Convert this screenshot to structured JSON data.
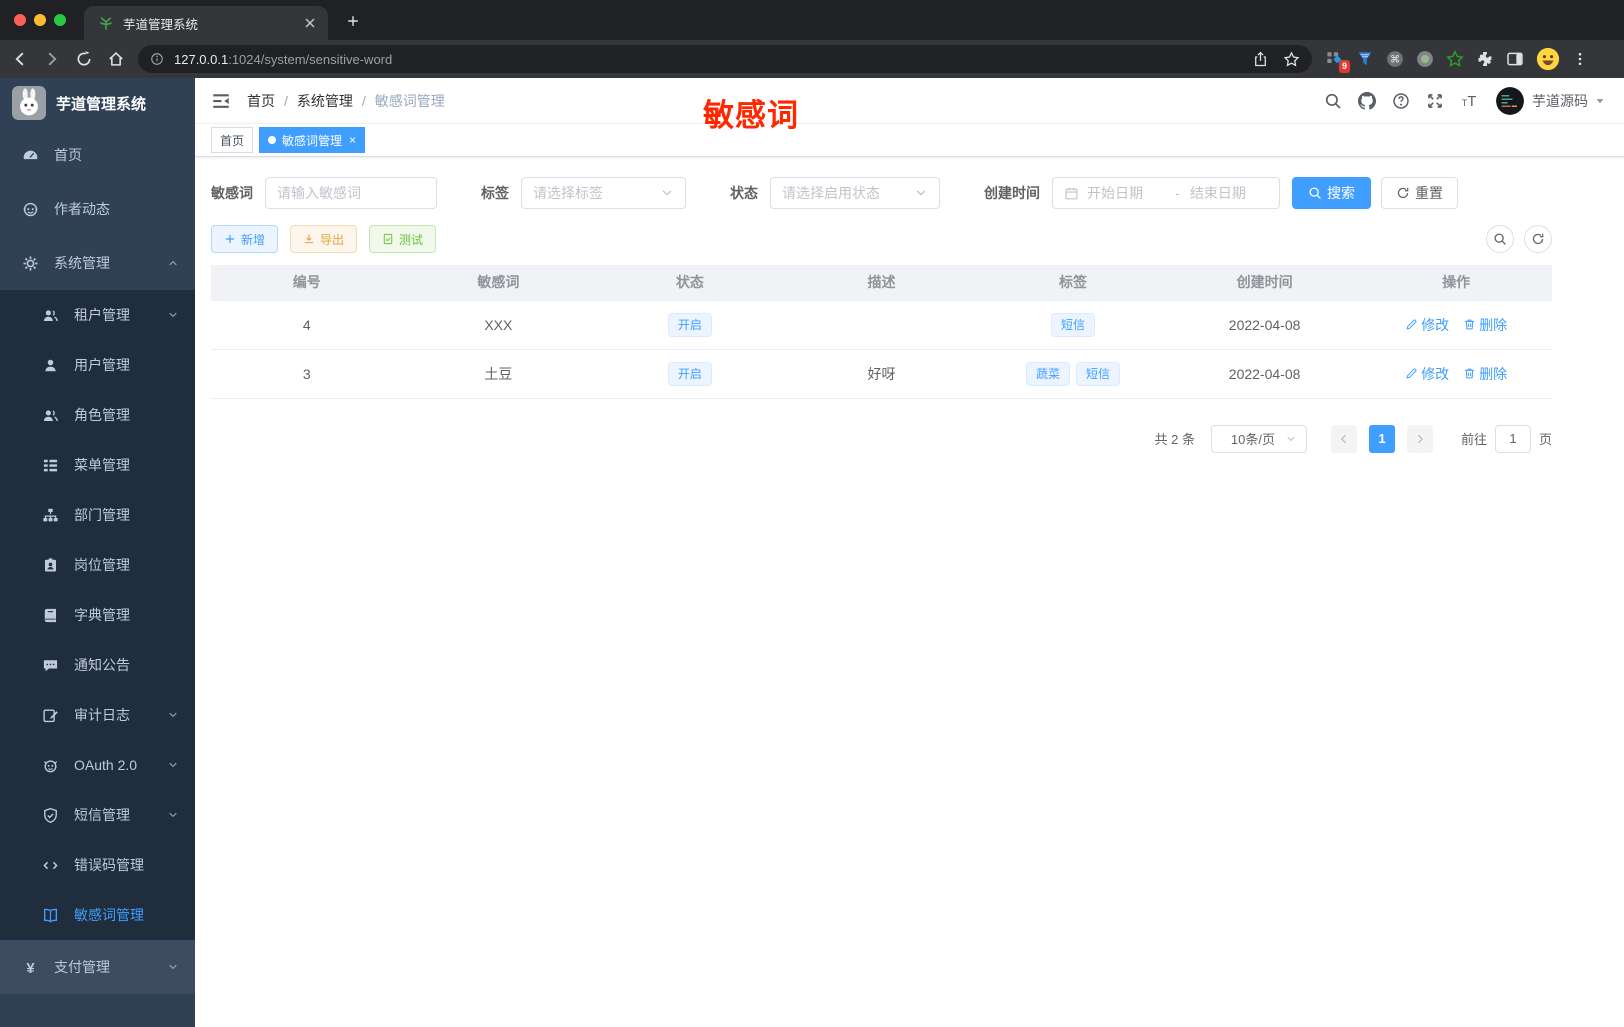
{
  "browser": {
    "tab_title": "芋道管理系统",
    "url_host": "127.0.0.1",
    "url_rest": ":1024/system/sensitive-word",
    "extension_badge": "9",
    "extensions": [
      "workona-icon",
      "funnel-icon",
      "command-circle-icon",
      "record-circle-icon",
      "green-star-icon",
      "puzzle-icon",
      "split-view-icon",
      "profile-avatar-icon",
      "menu-dots-icon"
    ]
  },
  "sidebar": {
    "title": "芋道管理系统",
    "items": [
      {
        "label": "首页",
        "icon": "gauge-icon",
        "level": 1
      },
      {
        "label": "作者动态",
        "icon": "author-icon",
        "level": 1
      },
      {
        "label": "系统管理",
        "icon": "gear-icon",
        "level": 1,
        "chevron": "up"
      },
      {
        "label": "租户管理",
        "icon": "users-icon",
        "level": 2,
        "chevron": "down"
      },
      {
        "label": "用户管理",
        "icon": "user-icon",
        "level": 2
      },
      {
        "label": "角色管理",
        "icon": "users-icon",
        "level": 2
      },
      {
        "label": "菜单管理",
        "icon": "menu-tree-icon",
        "level": 2
      },
      {
        "label": "部门管理",
        "icon": "org-icon",
        "level": 2
      },
      {
        "label": "岗位管理",
        "icon": "badge-icon",
        "level": 2
      },
      {
        "label": "字典管理",
        "icon": "dict-icon",
        "level": 2
      },
      {
        "label": "通知公告",
        "icon": "notice-icon",
        "level": 2
      },
      {
        "label": "审计日志",
        "icon": "log-icon",
        "level": 2,
        "chevron": "down"
      },
      {
        "label": "OAuth 2.0",
        "icon": "oauth-icon",
        "level": 2,
        "chevron": "down"
      },
      {
        "label": "短信管理",
        "icon": "shield-check-icon",
        "level": 2,
        "chevron": "down"
      },
      {
        "label": "错误码管理",
        "icon": "code-icon",
        "level": 2
      },
      {
        "label": "敏感词管理",
        "icon": "open-book-icon",
        "level": 2,
        "active": true
      },
      {
        "label": "支付管理",
        "icon": "yen-icon",
        "level": 1,
        "chevron": "down",
        "highlight": true
      }
    ]
  },
  "header": {
    "breadcrumb": [
      "首页",
      "系统管理",
      "敏感词管理"
    ],
    "annotation": "敏感词",
    "username": "芋道源码"
  },
  "tags": [
    {
      "label": "首页"
    },
    {
      "label": "敏感词管理",
      "active": true,
      "closable": true
    }
  ],
  "filters": {
    "keyword_label": "敏感词",
    "keyword_placeholder": "请输入敏感词",
    "tag_label": "标签",
    "tag_placeholder": "请选择标签",
    "status_label": "状态",
    "status_placeholder": "请选择启用状态",
    "date_label": "创建时间",
    "date_start_placeholder": "开始日期",
    "date_separator": "-",
    "date_end_placeholder": "结束日期",
    "search_label": "搜索",
    "reset_label": "重置"
  },
  "toolbar": {
    "add_label": "新增",
    "export_label": "导出",
    "test_label": "测试"
  },
  "table": {
    "columns": [
      "编号",
      "敏感词",
      "状态",
      "描述",
      "标签",
      "创建时间",
      "操作"
    ],
    "rows": [
      {
        "id": "4",
        "word": "XXX",
        "status": "开启",
        "description": "",
        "tags": [
          "短信"
        ],
        "created": "2022-04-08"
      },
      {
        "id": "3",
        "word": "土豆",
        "status": "开启",
        "description": "好呀",
        "tags": [
          "蔬菜",
          "短信"
        ],
        "created": "2022-04-08"
      }
    ],
    "edit_label": "修改",
    "delete_label": "删除"
  },
  "pagination": {
    "total_text": "共 2 条",
    "page_size": "10条/页",
    "current_page": "1",
    "goto_label": "前往",
    "goto_value": "1",
    "page_label": "页"
  },
  "colors": {
    "primary": "#409eff",
    "annotation_red": "#ff2600",
    "sidebar_bg": "#304156",
    "submenu_bg": "#1f2d3d",
    "warning": "#e6a23c",
    "success": "#67c23a",
    "tag_bg": "#ecf5ff",
    "tag_border": "#d9ecff"
  }
}
